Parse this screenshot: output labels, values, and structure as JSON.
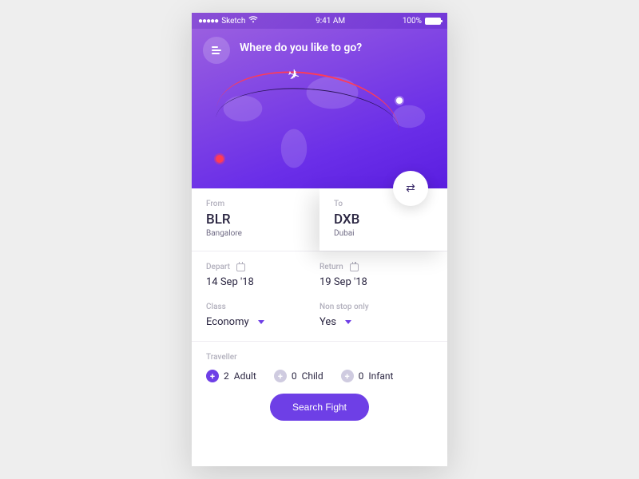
{
  "status_bar": {
    "carrier": "Sketch",
    "time": "9:41 AM",
    "battery": "100%"
  },
  "hero": {
    "title": "Where do you like to go?"
  },
  "route": {
    "from": {
      "label": "From",
      "code": "BLR",
      "city": "Bangalore"
    },
    "to": {
      "label": "To",
      "code": "DXB",
      "city": "Dubai"
    }
  },
  "dates": {
    "depart": {
      "label": "Depart",
      "value": "14 Sep '18"
    },
    "return": {
      "label": "Return",
      "value": "19 Sep '18"
    }
  },
  "options": {
    "class": {
      "label": "Class",
      "value": "Economy"
    },
    "nonstop": {
      "label": "Non stop only",
      "value": "Yes"
    }
  },
  "traveller": {
    "label": "Traveller",
    "adult": {
      "count": 2,
      "unit": "Adult"
    },
    "child": {
      "count": 0,
      "unit": "Child"
    },
    "infant": {
      "count": 0,
      "unit": "Infant"
    }
  },
  "cta": {
    "search": "Search Fight"
  }
}
